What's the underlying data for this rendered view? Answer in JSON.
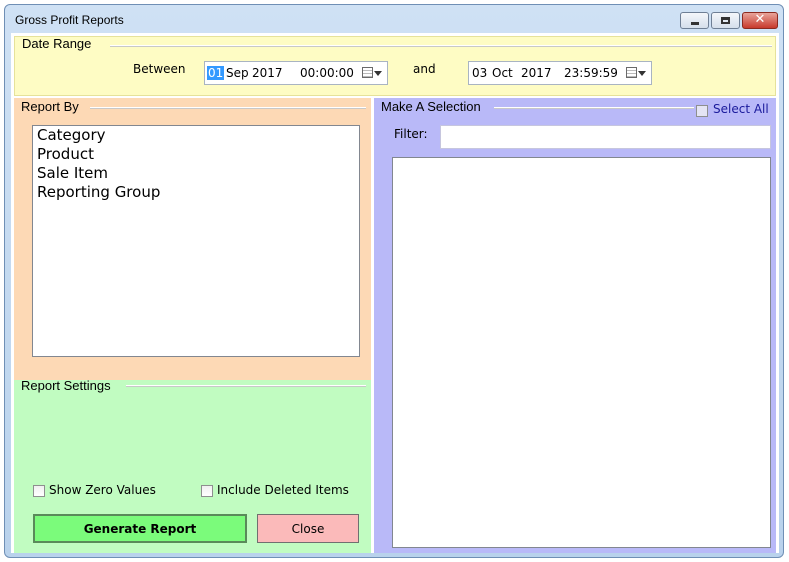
{
  "window": {
    "title": "Gross Profit Reports",
    "close_glyph": "✕"
  },
  "date_range": {
    "title": "Date Range",
    "between_label": "Between",
    "and_label": "and",
    "from": {
      "day": "01",
      "month": "Sep",
      "year": "2017",
      "time": "00:00:00"
    },
    "to": {
      "day": "03",
      "month": "Oct",
      "year": "2017",
      "time": "23:59:59"
    }
  },
  "report_by": {
    "title": "Report By",
    "items": [
      "Category",
      "Product",
      "Sale Item",
      "Reporting Group"
    ]
  },
  "selection": {
    "title": "Make A Selection",
    "select_all_label": "Select All",
    "filter_label": "Filter:",
    "filter_value": ""
  },
  "settings": {
    "title": "Report Settings",
    "show_zero_label": "Show Zero Values",
    "include_deleted_label": "Include Deleted Items",
    "generate_label": "Generate Report",
    "close_label": "Close"
  },
  "colors": {
    "date_panel": "#fefcc4",
    "report_by": "#fdd9b5",
    "settings": "#c1fcc1",
    "selection": "#b9b9f8",
    "generate": "#7bfb7b",
    "close": "#fbbaba"
  },
  "icons": {
    "calendar": "calendar-icon",
    "dropdown": "chevron-down-icon"
  }
}
